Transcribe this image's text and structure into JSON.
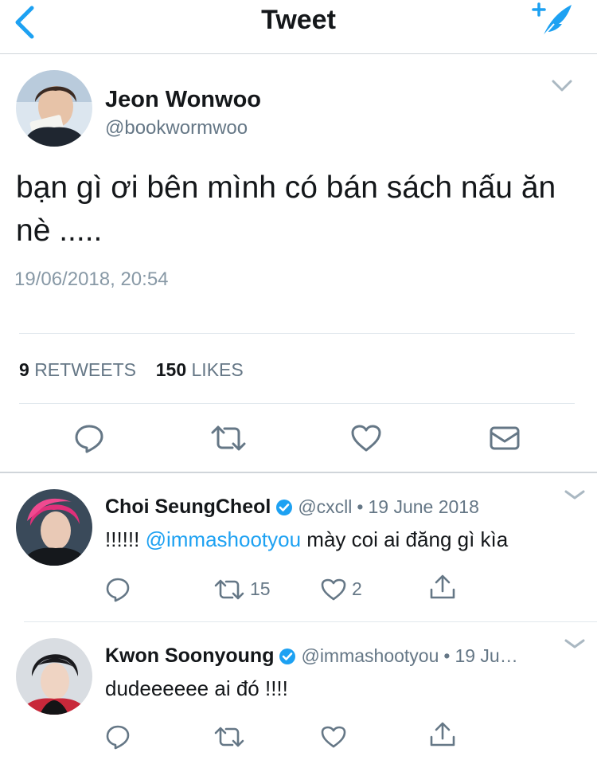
{
  "nav": {
    "title": "Tweet"
  },
  "tweet": {
    "author_name": "Jeon Wonwoo",
    "author_handle": "@bookwormwoo",
    "text": "bạn gì ơi bên mình có bán sách nấu ăn nè .....",
    "timestamp": "19/06/2018, 20:54",
    "retweet_count": "9",
    "retweet_label": "RETWEETS",
    "like_count": "150",
    "like_label": "LIKES"
  },
  "replies": [
    {
      "name": "Choi SeungCheol",
      "handle": "@cxcll",
      "separator": "•",
      "date": "19 June 2018",
      "mention": "@immashootyou",
      "text_prefix": "!!!!!!",
      "text_suffix": "mày coi ai đăng gì kìa",
      "retweets": "15",
      "likes": "2"
    },
    {
      "name": "Kwon Soonyoung",
      "handle": "@immashootyou",
      "separator": "•",
      "date": "19 Ju…",
      "text": "dudeeeeee ai đó !!!!"
    }
  ],
  "icons": {
    "back": "chevron-left-icon",
    "compose": "compose-feather-icon",
    "reply": "reply-icon",
    "retweet": "retweet-icon",
    "like": "heart-icon",
    "message": "envelope-icon",
    "share": "share-icon",
    "more": "chevron-down-icon",
    "verified": "verified-badge-icon"
  },
  "colors": {
    "accent": "#1da1f2",
    "text": "#14171a",
    "muted": "#657786",
    "divider": "#e1e8ed"
  }
}
